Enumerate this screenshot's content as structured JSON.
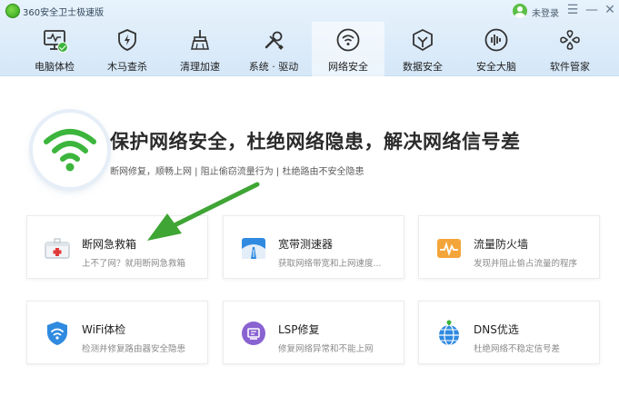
{
  "app": {
    "title": "360安全卫士极速版",
    "login": "未登录"
  },
  "window": {
    "menu_glyph": "☰",
    "min_glyph": "—",
    "close_glyph": "✕"
  },
  "nav": [
    {
      "label": "电脑体检",
      "icon": "monitor-check-icon"
    },
    {
      "label": "木马查杀",
      "icon": "shield-bolt-icon"
    },
    {
      "label": "清理加速",
      "icon": "broom-icon"
    },
    {
      "label": "系统 · 驱动",
      "icon": "wrench-screwdriver-icon"
    },
    {
      "label": "网络安全",
      "icon": "wifi-icon",
      "active": true
    },
    {
      "label": "数据安全",
      "icon": "cube-shield-icon"
    },
    {
      "label": "安全大脑",
      "icon": "brain-icon"
    },
    {
      "label": "软件管家",
      "icon": "apps-icon"
    }
  ],
  "hero": {
    "title": "保护网络安全，杜绝网络隐患，解决网络信号差",
    "subtitle": "断网修复，顺畅上网  |  阻止偷窃流量行为  |  杜绝路由不安全隐患"
  },
  "cards": [
    {
      "title": "断网急救箱",
      "desc": "上不了网？就用断网急救箱"
    },
    {
      "title": "宽带测速器",
      "desc": "获取网络带宽和上网速度..."
    },
    {
      "title": "流量防火墙",
      "desc": "发现并阻止偷占流量的程序"
    },
    {
      "title": "WiFi体检",
      "desc": "检测并修复路由器安全隐患"
    },
    {
      "title": "LSP修复",
      "desc": "修复网络异常和不能上网"
    },
    {
      "title": "DNS优选",
      "desc": "杜绝网络不稳定信号差"
    }
  ],
  "colors": {
    "accent_green": "#3cb53c",
    "arrow_green": "#3fa535",
    "header_bg": "#dcebf9"
  }
}
